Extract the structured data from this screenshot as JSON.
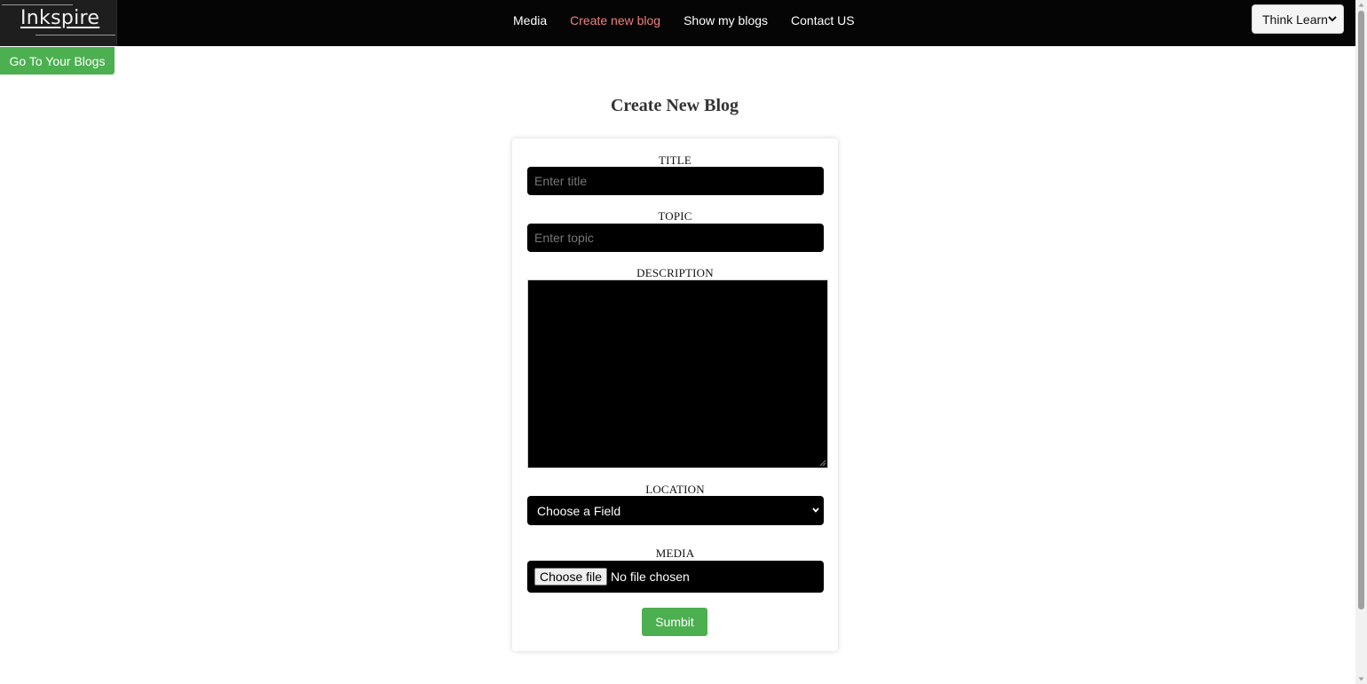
{
  "brand": {
    "logo_text": "Inkspire"
  },
  "nav": {
    "links": [
      {
        "label": "Media",
        "active": false
      },
      {
        "label": "Create new blog",
        "active": true
      },
      {
        "label": "Show my blogs",
        "active": false
      },
      {
        "label": "Contact US",
        "active": false
      }
    ],
    "active_color": "#f08080"
  },
  "language_select": {
    "selected": "Think Learn"
  },
  "go_blogs_button": {
    "label": "Go To Your Blogs"
  },
  "page": {
    "title": "Create New Blog"
  },
  "form": {
    "title": {
      "label": "TITLE",
      "placeholder": "Enter title",
      "value": ""
    },
    "topic": {
      "label": "TOPIC",
      "placeholder": "Enter topic",
      "value": ""
    },
    "description": {
      "label": "DESCRIPTION",
      "value": ""
    },
    "location": {
      "label": "LOCATION",
      "selected": "Choose a Field"
    },
    "media": {
      "label": "MEDIA",
      "button_label": "Choose file",
      "status": "No file chosen"
    },
    "submit_label": "Sumbit"
  },
  "colors": {
    "navbar_bg": "#050505",
    "accent_green": "#4caf50",
    "input_bg": "#000000"
  },
  "icons": {
    "select_chevron": "chevron-down-icon",
    "textarea_resize": "resize-grip-icon"
  }
}
